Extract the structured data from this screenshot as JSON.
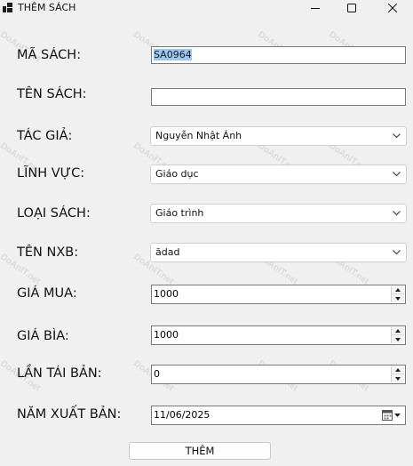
{
  "window": {
    "title": "THÊM SÁCH"
  },
  "form": {
    "ma_sach": {
      "label": "MÃ SÁCH:",
      "value": "SA0964"
    },
    "ten_sach": {
      "label": "TÊN SÁCH:",
      "value": ""
    },
    "tac_gia": {
      "label": "TÁC GIẢ:",
      "value": "Nguyễn Nhật Ánh"
    },
    "linh_vuc": {
      "label": "LĨNH VỰC:",
      "value": "Giáo dục"
    },
    "loai_sach": {
      "label": "LOẠI SÁCH:",
      "value": "Giáo trình"
    },
    "ten_nxb": {
      "label": "TÊN NXB:",
      "value": "ădad"
    },
    "gia_mua": {
      "label": "GIÁ MUA:",
      "value": "1000"
    },
    "gia_bia": {
      "label": "GIÁ BÌA:",
      "value": "1000"
    },
    "lan_tai_ban": {
      "label": "LẦN TÁI BẢN:",
      "value": "0"
    },
    "nam_xuat_ban": {
      "label": "NĂM XUẤT BẢN:",
      "value": "11/06/2025"
    }
  },
  "actions": {
    "submit_label": "THÊM"
  },
  "watermark": {
    "text": "DoAnIT.net"
  },
  "icons": {
    "app": "app-icon",
    "minimize": "minimize-icon",
    "maximize": "maximize-icon",
    "close": "close-icon",
    "dropdown": "chevron-down-icon",
    "calendar": "calendar-icon"
  }
}
